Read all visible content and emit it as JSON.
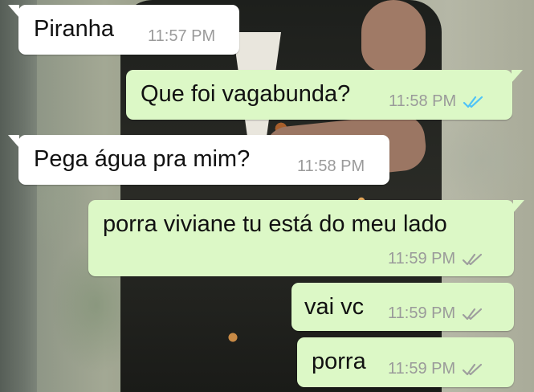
{
  "chat": {
    "tick_colors": {
      "read": "#4fc3f7",
      "delivered": "#9e9e9e"
    },
    "messages": [
      {
        "direction": "incoming",
        "text": "Piranha",
        "time": "11:57 PM"
      },
      {
        "direction": "outgoing",
        "text": "Que foi vagabunda?",
        "time": "11:58 PM",
        "ticks": "read",
        "tick_icon": "double-check-icon"
      },
      {
        "direction": "incoming",
        "text": "Pega água pra mim?",
        "time": "11:58 PM"
      },
      {
        "direction": "outgoing",
        "text": "porra viviane tu está do meu lado",
        "time": "11:59 PM",
        "ticks": "delivered",
        "tick_icon": "double-check-icon"
      },
      {
        "direction": "outgoing",
        "text": "vai vc",
        "time": "11:59 PM",
        "ticks": "delivered",
        "tick_icon": "double-check-icon"
      },
      {
        "direction": "outgoing",
        "text": "porra",
        "time": "11:59 PM",
        "ticks": "delivered",
        "tick_icon": "double-check-icon"
      }
    ]
  }
}
